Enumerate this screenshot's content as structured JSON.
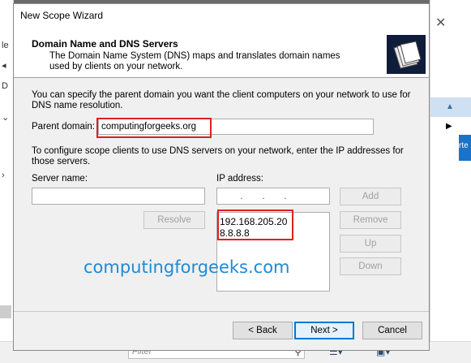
{
  "wizard": {
    "title": "New Scope Wizard",
    "header_title": "Domain Name and DNS Servers",
    "header_desc": "The Domain Name System (DNS) maps and translates domain names used by clients on your network.",
    "intro": "You can specify the parent domain you want the client computers on your network to use for DNS name resolution.",
    "parent_domain_label": "Parent domain:",
    "parent_domain_value": "computingforgeeks.org",
    "dns_desc": "To configure scope clients to use DNS servers on your network, enter the IP addresses for those servers.",
    "server_name_label": "Server name:",
    "server_name_value": "",
    "ip_address_label": "IP address:",
    "ip_input_dots": "...",
    "ip_list": [
      "192.168.205.20",
      "8.8.8.8"
    ],
    "buttons": {
      "resolve": "Resolve",
      "add": "Add",
      "remove": "Remove",
      "up": "Up",
      "down": "Down",
      "back": "< Back",
      "next": "Next >",
      "cancel": "Cancel"
    }
  },
  "watermark": "computingforgeeks.com",
  "background": {
    "left_glyphs": [
      "le",
      "D"
    ],
    "right_button_text": "rte",
    "filter_placeholder": "Filter"
  },
  "colors": {
    "highlight": "#e0201c",
    "watermark": "#1d8ad6",
    "default_button": "#0078d7"
  }
}
